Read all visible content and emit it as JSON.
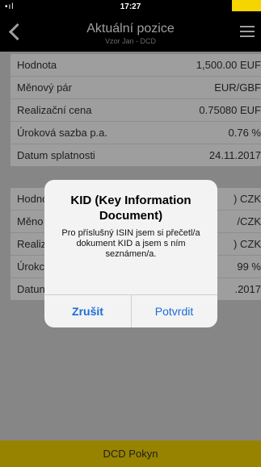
{
  "statusbar": {
    "time": "17:27"
  },
  "nav": {
    "title": "Aktuální pozice",
    "subtitle": "Vzor Jan - DCD"
  },
  "card1": [
    {
      "label": "Hodnota",
      "value": "1,500.00 EUF"
    },
    {
      "label": "Měnový pár",
      "value": "EUR/GBF"
    },
    {
      "label": "Realizační cena",
      "value": "0.75080 EUF"
    },
    {
      "label": "Úroková sazba p.a.",
      "value": "0.76 %"
    },
    {
      "label": "Datum splatnosti",
      "value": "24.11.2017"
    }
  ],
  "card2": [
    {
      "label": "Hodno",
      "value": ") CZK"
    },
    {
      "label": "Měno",
      "value": "/CZK"
    },
    {
      "label": "Realiz",
      "value": ") CZK"
    },
    {
      "label": "Úrokc",
      "value": "99 %"
    },
    {
      "label": "Datun",
      "value": ".2017"
    }
  ],
  "dialog": {
    "title": "KID (Key Information Document)",
    "message": "Pro příslušný ISIN jsem si přečetl/a dokument KID a jsem s ním seznámen/a.",
    "cancel": "Zrušit",
    "confirm": "Potvrdit"
  },
  "footer": {
    "button": "DCD Pokyn"
  },
  "colors": {
    "accent": "#f5d400",
    "link": "#1c6cd6"
  }
}
